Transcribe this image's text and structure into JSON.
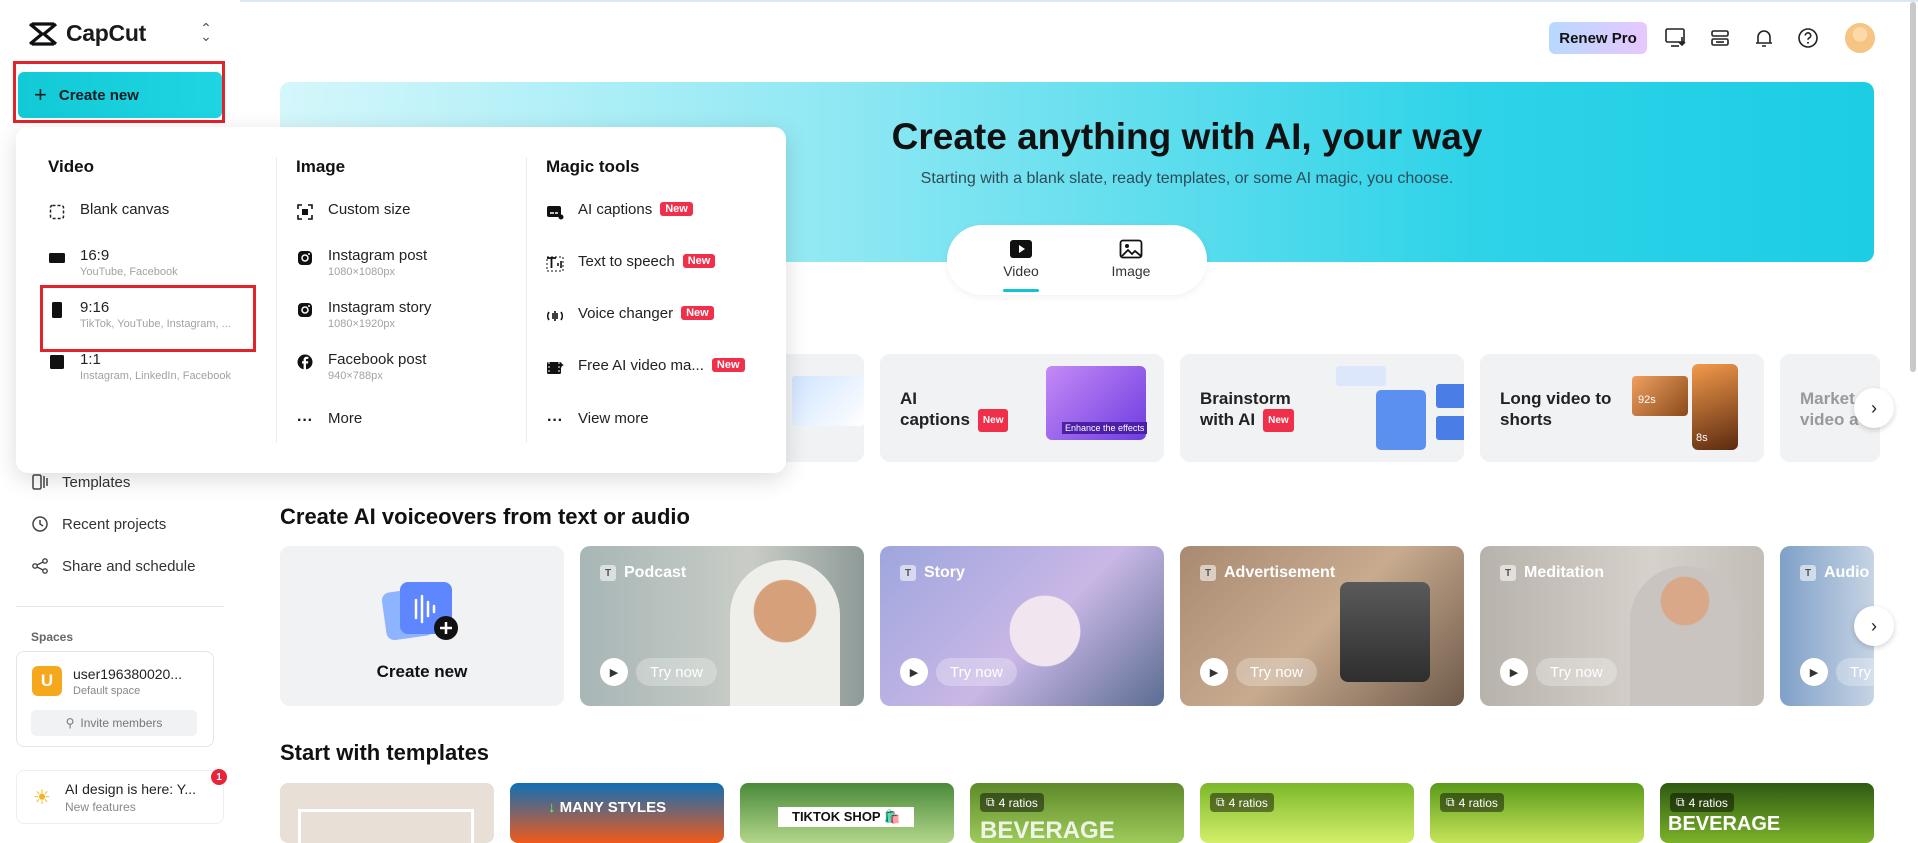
{
  "app": {
    "name": "CapCut",
    "brand_color": "#12c9d6"
  },
  "sidebar": {
    "create_new_label": "Create new",
    "nav": [
      {
        "label": "Templates",
        "icon": "templates-icon"
      },
      {
        "label": "Recent projects",
        "icon": "clock-icon"
      },
      {
        "label": "Share and schedule",
        "icon": "share-icon"
      }
    ],
    "spaces_title": "Spaces",
    "space": {
      "initial": "U",
      "name": "user196380020...",
      "subtitle": "Default space",
      "invite_label": "Invite members"
    },
    "news": {
      "title": "AI design is here: Y...",
      "subtitle": "New features",
      "badge": "1"
    }
  },
  "header": {
    "renew_label": "Renew Pro",
    "icons": [
      "desktop-download-icon",
      "stack-icon",
      "bell-icon",
      "help-icon",
      "user-avatar"
    ]
  },
  "hero": {
    "title": "Create anything with AI, your way",
    "subtitle": "Starting with a blank slate, ready templates, or some AI magic, you choose.",
    "tabs": [
      {
        "label": "Video",
        "active": true
      },
      {
        "label": "Image",
        "active": false
      }
    ]
  },
  "dropdown": {
    "video": {
      "title": "Video",
      "items": [
        {
          "label": "Blank canvas",
          "sub": ""
        },
        {
          "label": "16:9",
          "sub": "YouTube, Facebook"
        },
        {
          "label": "9:16",
          "sub": "TikTok, YouTube, Instagram, ..."
        },
        {
          "label": "1:1",
          "sub": "Instagram, LinkedIn, Facebook"
        }
      ]
    },
    "image": {
      "title": "Image",
      "items": [
        {
          "label": "Custom size",
          "sub": ""
        },
        {
          "label": "Instagram post",
          "sub": "1080×1080px"
        },
        {
          "label": "Instagram story",
          "sub": "1080×1920px"
        },
        {
          "label": "Facebook post",
          "sub": "940×788px"
        },
        {
          "label": "More",
          "sub": ""
        }
      ]
    },
    "magic": {
      "title": "Magic tools",
      "items": [
        {
          "label": "AI captions",
          "badge": "New"
        },
        {
          "label": "Text to speech",
          "badge": "New"
        },
        {
          "label": "Voice changer",
          "badge": "New"
        },
        {
          "label": "Free AI video ma...",
          "badge": "New"
        },
        {
          "label": "View more",
          "badge": ""
        }
      ]
    }
  },
  "features": [
    {
      "line1": "AI",
      "line2": "captions",
      "badge": "New"
    },
    {
      "line1": "Brainstorm",
      "line2": "with AI",
      "badge": "New"
    },
    {
      "line1": "Long video to",
      "line2": "shorts",
      "badge": ""
    },
    {
      "line1": "Market",
      "line2": "video a",
      "badge": ""
    }
  ],
  "feature_media": {
    "enhance_caption": "Enhance the effects",
    "long_badge_1": "92s",
    "long_badge_2": "8s"
  },
  "voiceovers": {
    "title": "Create AI voiceovers from text or audio",
    "create_new_label": "Create new",
    "cards": [
      {
        "label": "Podcast",
        "cta": "Try now"
      },
      {
        "label": "Story",
        "cta": "Try now"
      },
      {
        "label": "Advertisement",
        "cta": "Try now"
      },
      {
        "label": "Meditation",
        "cta": "Try now"
      },
      {
        "label": "Audio",
        "cta": "Try"
      }
    ]
  },
  "templates": {
    "title": "Start with templates",
    "cards": [
      {
        "ratio": "",
        "text": ""
      },
      {
        "ratio": "",
        "text": "MANY STYLES"
      },
      {
        "ratio": "",
        "text": "TIKTOK SHOP 🛍️"
      },
      {
        "ratio": "4 ratios",
        "text": "BEVERAGE"
      },
      {
        "ratio": "4 ratios",
        "text": ""
      },
      {
        "ratio": "4 ratios",
        "text": ""
      },
      {
        "ratio": "4 ratios",
        "text": "BEVERAGE"
      }
    ]
  }
}
